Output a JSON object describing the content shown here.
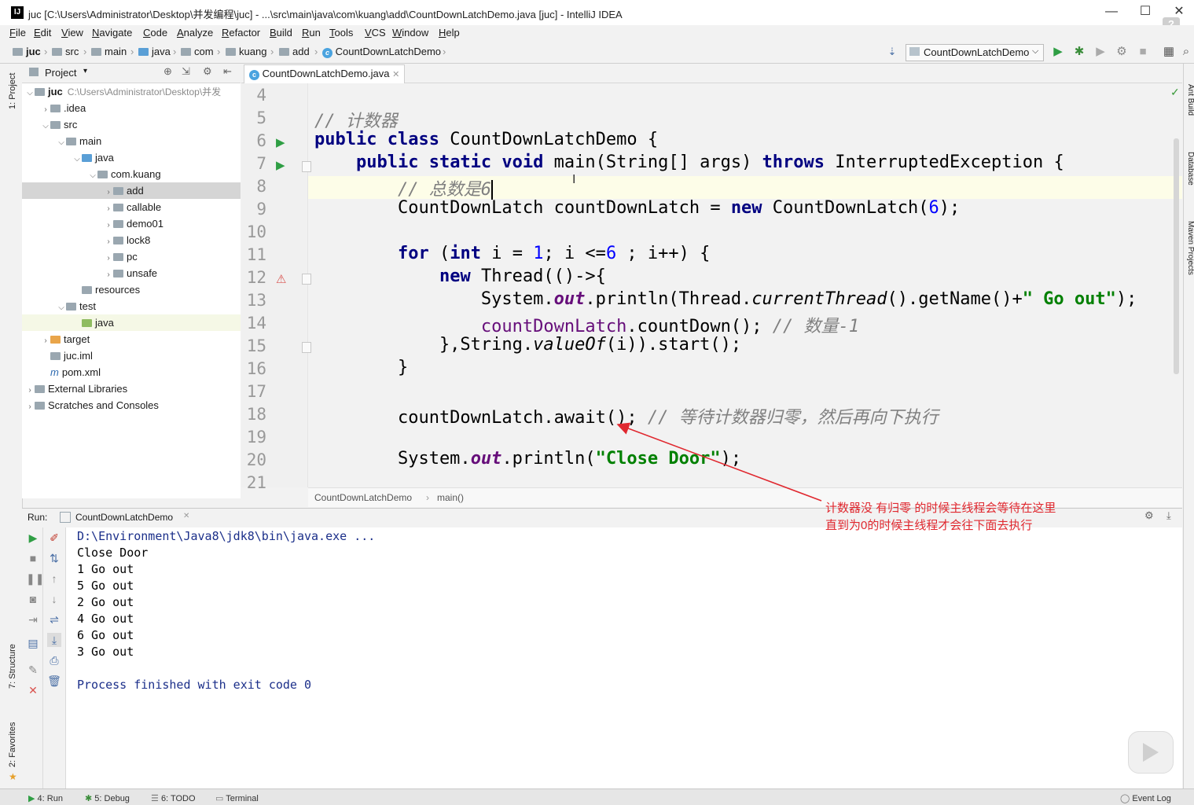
{
  "window": {
    "title": "juc [C:\\Users\\Administrator\\Desktop\\并发编程\\juc] - ...\\src\\main\\java\\com\\kuang\\add\\CountDownLatchDemo.java [juc] - IntelliJ IDEA",
    "logo": "IJ",
    "help_glyph": "?"
  },
  "menu": [
    "File",
    "Edit",
    "View",
    "Navigate",
    "Code",
    "Analyze",
    "Refactor",
    "Build",
    "Run",
    "Tools",
    "VCS",
    "Window",
    "Help"
  ],
  "nav": {
    "crumbs": [
      "juc",
      "src",
      "main",
      "java",
      "com",
      "kuang",
      "add",
      "CountDownLatchDemo"
    ],
    "run_config": "CountDownLatchDemo"
  },
  "left_tools": {
    "project": "1: Project",
    "structure": "7: Structure",
    "favorites": "2: Favorites"
  },
  "right_tools": {
    "ant": "Ant Build",
    "database": "Database",
    "maven": "Maven Projects"
  },
  "project": {
    "header": "Project",
    "tree": [
      {
        "label": "juc",
        "extra": "C:\\Users\\Administrator\\Desktop\\并发",
        "indent": 0,
        "arrow": "v",
        "icon": "folder"
      },
      {
        "label": ".idea",
        "indent": 1,
        "arrow": ">",
        "icon": "folder"
      },
      {
        "label": "src",
        "indent": 1,
        "arrow": "v",
        "icon": "folder"
      },
      {
        "label": "main",
        "indent": 2,
        "arrow": "v",
        "icon": "folder"
      },
      {
        "label": "java",
        "indent": 3,
        "arrow": "v",
        "icon": "folder-blue"
      },
      {
        "label": "com.kuang",
        "indent": 4,
        "arrow": "v",
        "icon": "folder"
      },
      {
        "label": "add",
        "indent": 5,
        "arrow": ">",
        "icon": "folder",
        "state": "selected"
      },
      {
        "label": "callable",
        "indent": 5,
        "arrow": ">",
        "icon": "folder"
      },
      {
        "label": "demo01",
        "indent": 5,
        "arrow": ">",
        "icon": "folder"
      },
      {
        "label": "lock8",
        "indent": 5,
        "arrow": ">",
        "icon": "folder"
      },
      {
        "label": "pc",
        "indent": 5,
        "arrow": ">",
        "icon": "folder"
      },
      {
        "label": "unsafe",
        "indent": 5,
        "arrow": ">",
        "icon": "folder"
      },
      {
        "label": "resources",
        "indent": 3,
        "arrow": "",
        "icon": "folder"
      },
      {
        "label": "test",
        "indent": 2,
        "arrow": "v",
        "icon": "folder"
      },
      {
        "label": "java",
        "indent": 3,
        "arrow": "",
        "icon": "folder-green",
        "state": "highlight"
      },
      {
        "label": "target",
        "indent": 1,
        "arrow": ">",
        "icon": "folder-orange"
      },
      {
        "label": "juc.iml",
        "indent": 1,
        "arrow": "",
        "icon": "file"
      },
      {
        "label": "pom.xml",
        "indent": 1,
        "arrow": "",
        "icon": "maven"
      },
      {
        "label": "External Libraries",
        "indent": 0,
        "arrow": ">",
        "icon": "lib"
      },
      {
        "label": "Scratches and Consoles",
        "indent": 0,
        "arrow": ">",
        "icon": "scratch"
      }
    ]
  },
  "editor": {
    "tab": "CountDownLatchDemo.java",
    "line_numbers": [
      "4",
      "5",
      "6",
      "7",
      "8",
      "9",
      "10",
      "11",
      "12",
      "13",
      "14",
      "15",
      "16",
      "17",
      "18",
      "19",
      "20",
      "21"
    ],
    "breadcrumb": [
      "CountDownLatchDemo",
      "main()"
    ]
  },
  "annotation": {
    "line1": "计数器没 有归零 的时候主线程会等待在这里",
    "line2": "直到为0的时候主线程才会往下面去执行",
    "color": "#e0282f"
  },
  "run": {
    "label": "Run:",
    "tab": "CountDownLatchDemo",
    "output": [
      "D:\\Environment\\Java8\\jdk8\\bin\\java.exe ...",
      "Close Door",
      "1 Go out",
      "5 Go out",
      "2 Go out",
      "4 Go out",
      "6 Go out",
      "3 Go out",
      "",
      "Process finished with exit code 0"
    ]
  },
  "status": {
    "tabs": [
      "4: Run",
      "5: Debug",
      "6: TODO",
      "Terminal"
    ],
    "event_log": "Event Log"
  }
}
